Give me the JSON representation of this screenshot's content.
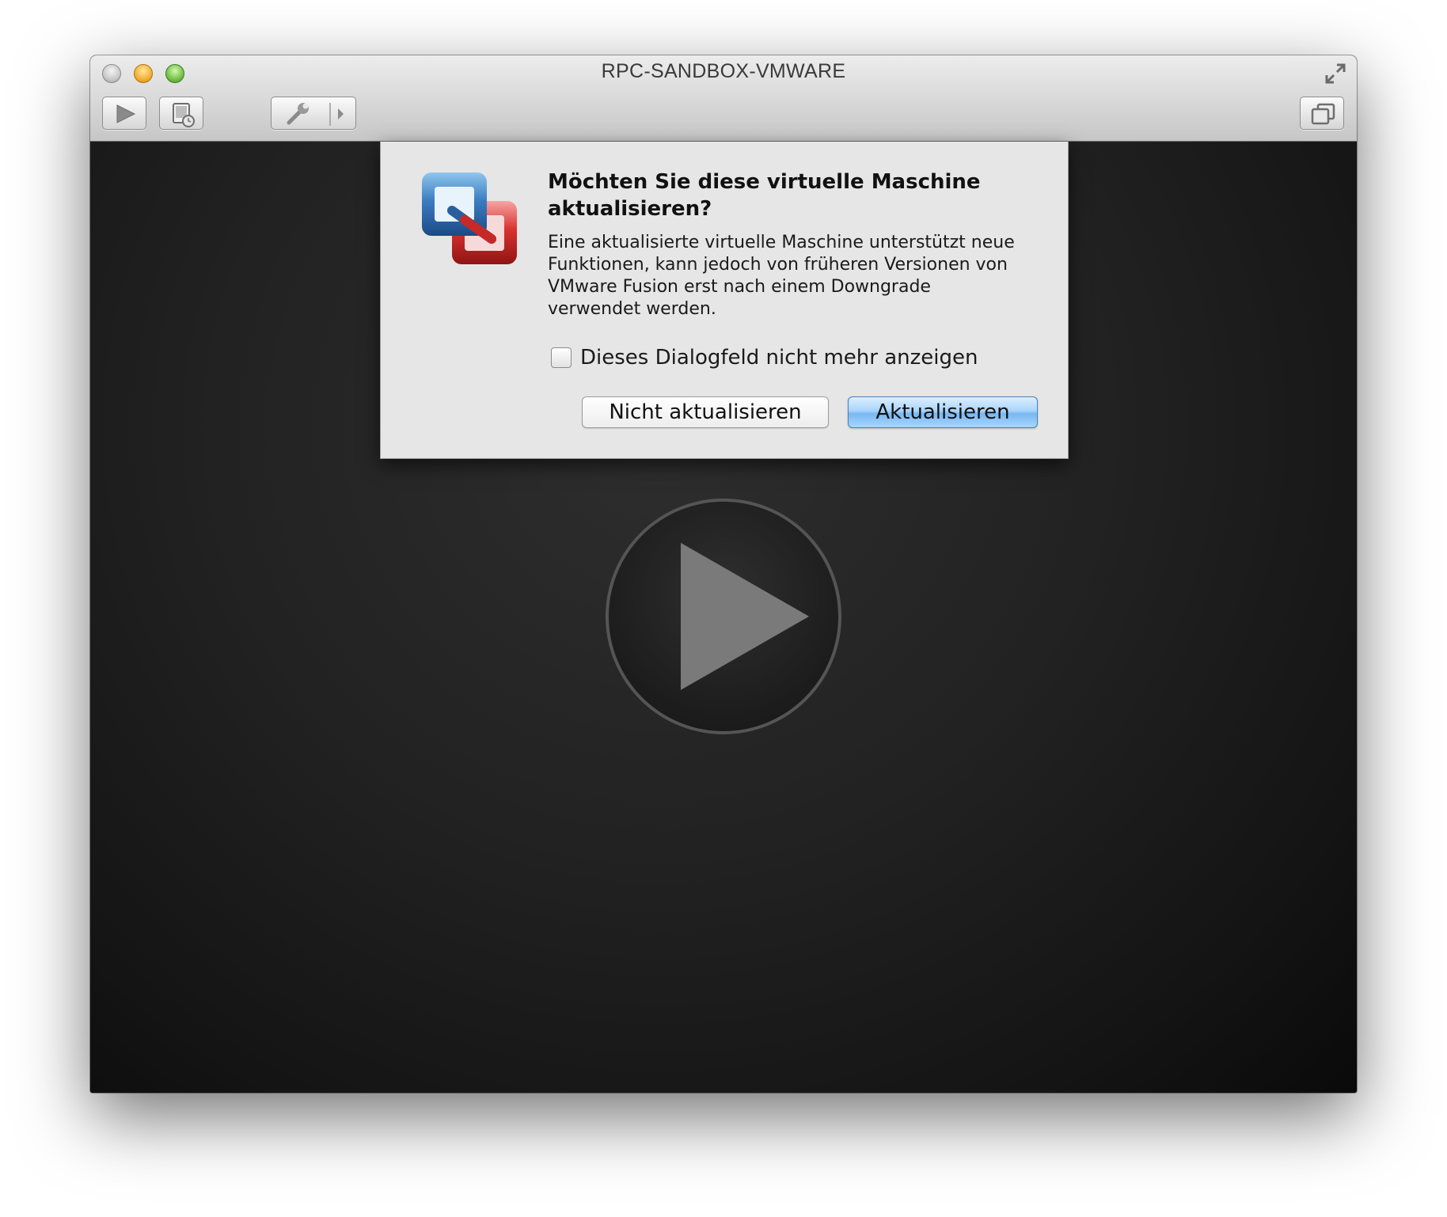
{
  "window": {
    "title": "RPC-SANDBOX-VMWARE"
  },
  "toolbar": {
    "buttons": [
      "play-icon",
      "snapshot-icon",
      "wrench-icon",
      "chevron-right-icon",
      "window-copy-icon"
    ]
  },
  "dialog": {
    "headline": "Möchten Sie diese virtuelle Maschine aktualisieren?",
    "body": "Eine aktualisierte virtuelle Maschine unterstützt neue Funktionen, kann jedoch von früheren Versionen von VMware Fusion erst nach einem Downgrade verwendet werden.",
    "checkbox_label": "Dieses Dialogfeld nicht mehr anzeigen",
    "checkbox_checked": false,
    "cancel_label": "Nicht aktualisieren",
    "confirm_label": "Aktualisieren",
    "icon": "vmware-fusion-icon"
  },
  "colors": {
    "accent_button": "#a9d4fb",
    "vm_background": "#1b1b1b"
  }
}
